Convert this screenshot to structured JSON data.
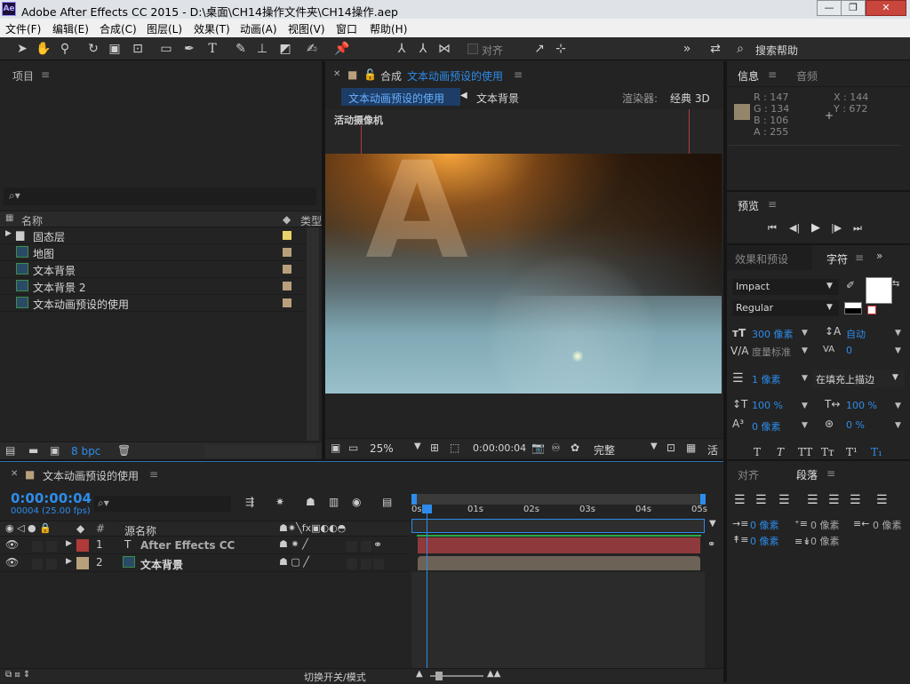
{
  "app": {
    "title": "Adobe After Effects CC 2015 - D:\\桌面\\CH14操作文件夹\\CH14操作.aep",
    "icon": "Ae"
  },
  "menu": [
    "文件(F)",
    "编辑(E)",
    "合成(C)",
    "图层(L)",
    "效果(T)",
    "动画(A)",
    "视图(V)",
    "窗口",
    "帮助(H)"
  ],
  "toolbar": {
    "align_label": "对齐",
    "search_help": "搜索帮助"
  },
  "project_panel": {
    "title": "项目",
    "col_name": "名称",
    "col_type": "类型",
    "items": [
      {
        "name": "固态层",
        "kind": "folder",
        "swatch": "#e8d36a"
      },
      {
        "name": "地图",
        "kind": "comp",
        "swatch": "#b8a07c"
      },
      {
        "name": "文本背景",
        "kind": "comp",
        "swatch": "#b8a07c"
      },
      {
        "name": "文本背景 2",
        "kind": "comp",
        "swatch": "#b8a07c"
      },
      {
        "name": "文本动画预设的使用",
        "kind": "comp",
        "swatch": "#b8a07c"
      }
    ],
    "bpc": "8 bpc"
  },
  "composition_panel": {
    "title_prefix": "合成",
    "title_name": "文本动画预设的使用",
    "crumb_active": "文本动画预设的使用",
    "crumb_next": "文本背景",
    "renderer_label": "渲染器:",
    "renderer_value": "经典 3D",
    "camera_label": "活动摄像机",
    "zoom": "25%",
    "timecode": "0:00:00:04",
    "resolution": "完整",
    "active_label": "活"
  },
  "info_panel": {
    "tab_info": "信息",
    "tab_audio": "音频",
    "r": "R : 147",
    "g": "G : 134",
    "b": "B : 106",
    "a": "A : 255",
    "x": "X : 144",
    "y": "Y : 672",
    "swatch_color": "#93866a"
  },
  "preview_panel": {
    "title": "预览"
  },
  "character_panel": {
    "tab_effects": "效果和预设",
    "tab_char": "字符",
    "font": "Impact",
    "style": "Regular",
    "size": "300 像素",
    "leading": "自动",
    "kerning": "度量标准",
    "tracking": "0",
    "stroke_width": "1 像素",
    "stroke_mode": "在填充上描边",
    "vscale": "100 %",
    "hscale": "100 %",
    "baseline": "0 像素",
    "tsume": "0 %"
  },
  "paragraph_panel": {
    "tab_align": "对齐",
    "tab_para": "段落",
    "indent_left": "0 像素",
    "indent_first": "0 像素",
    "indent_right": "0 像素",
    "space_before": "0 像素",
    "space_after": "0 像素"
  },
  "timeline": {
    "comp_name": "文本动画预设的使用",
    "timecode": "0:00:00:04",
    "frames": "00004 (25.00 fps)",
    "col_source": "源名称",
    "ruler": [
      "0s",
      "01s",
      "02s",
      "03s",
      "04s",
      "05s"
    ],
    "layers": [
      {
        "num": "1",
        "name": "After Effects CC",
        "color": "#b03a3a",
        "bar": "#8e3a3c"
      },
      {
        "num": "2",
        "name": "文本背景",
        "color": "#b8a07c",
        "bar": "#6c6256"
      }
    ],
    "switch_mode": "切换开关/模式"
  }
}
